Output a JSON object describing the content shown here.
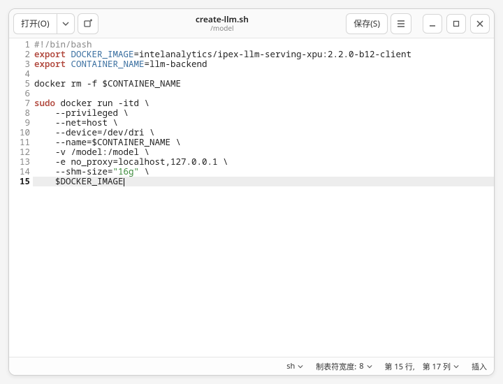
{
  "header": {
    "open_label": "打开(O)",
    "save_label": "保存(S)",
    "title": "create-llm.sh",
    "subtitle": "/model"
  },
  "code": {
    "lines": [
      {
        "n": 1,
        "segs": [
          {
            "t": "#!/bin/bash",
            "c": "tk-cmt"
          }
        ]
      },
      {
        "n": 2,
        "segs": [
          {
            "t": "export ",
            "c": "tk-key"
          },
          {
            "t": "DOCKER_IMAGE",
            "c": "tk-var"
          },
          {
            "t": "=intelanalytics/ipex-llm-serving-xpu:2.2.0-b12-client"
          }
        ]
      },
      {
        "n": 3,
        "segs": [
          {
            "t": "export ",
            "c": "tk-key"
          },
          {
            "t": "CONTAINER_NAME",
            "c": "tk-var"
          },
          {
            "t": "=llm-backend"
          }
        ]
      },
      {
        "n": 4,
        "segs": []
      },
      {
        "n": 5,
        "segs": [
          {
            "t": "docker rm -f $CONTAINER_NAME"
          }
        ]
      },
      {
        "n": 6,
        "segs": []
      },
      {
        "n": 7,
        "segs": [
          {
            "t": "sudo ",
            "c": "tk-key"
          },
          {
            "t": "docker run -itd \\"
          }
        ]
      },
      {
        "n": 8,
        "segs": [
          {
            "t": "    --privileged \\"
          }
        ]
      },
      {
        "n": 9,
        "segs": [
          {
            "t": "    --net=host \\"
          }
        ]
      },
      {
        "n": 10,
        "segs": [
          {
            "t": "    --device=/dev/dri \\"
          }
        ]
      },
      {
        "n": 11,
        "segs": [
          {
            "t": "    --name=$CONTAINER_NAME \\"
          }
        ]
      },
      {
        "n": 12,
        "segs": [
          {
            "t": "    -v /model:/model \\"
          }
        ]
      },
      {
        "n": 13,
        "segs": [
          {
            "t": "    -e no_proxy=localhost,127.0.0.1 \\"
          }
        ]
      },
      {
        "n": 14,
        "segs": [
          {
            "t": "    --shm-size="
          },
          {
            "t": "\"16g\"",
            "c": "tk-str"
          },
          {
            "t": " \\"
          }
        ]
      },
      {
        "n": 15,
        "current": true,
        "segs": [
          {
            "t": "    $DOCKER_IMAGE"
          }
        ],
        "cursor_after": true
      }
    ]
  },
  "status": {
    "lang": "sh",
    "tab_label": "制表符宽度:",
    "tab_value": "8",
    "pos_label_line": "第 15 行,",
    "pos_label_col": "第 17 列",
    "insert_mode": "插入"
  }
}
